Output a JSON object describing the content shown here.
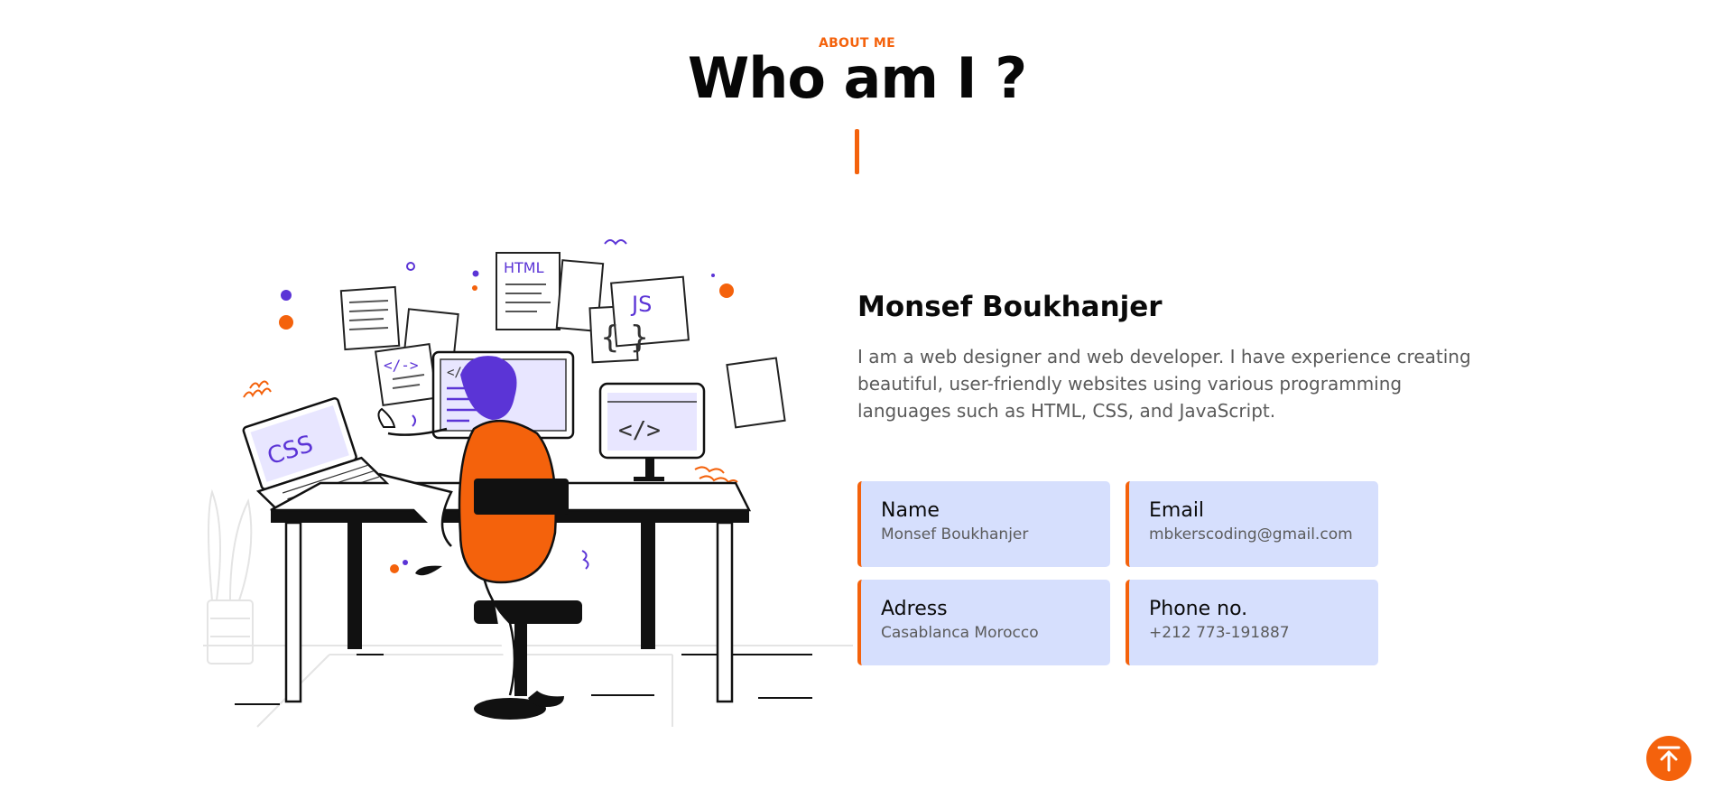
{
  "section": {
    "eyebrow": "ABOUT ME",
    "title": "Who am I ?"
  },
  "about": {
    "name": "Monsef Boukhanjer",
    "bio": "I am a web designer and web developer. I have experience creating beautiful, user-friendly websites using various programming languages such as HTML, CSS, and JavaScript."
  },
  "illustration": {
    "icon": "developer-at-desk-illustration",
    "labels": {
      "html": "HTML",
      "js": "JS",
      "css": "CSS"
    }
  },
  "info": {
    "name": {
      "label": "Name",
      "value": "Monsef Boukhanjer"
    },
    "email": {
      "label": "Email",
      "value": "mbkerscoding@gmail.com"
    },
    "address": {
      "label": "Adress",
      "value": "Casablanca Morocco"
    },
    "phone": {
      "label": "Phone no.",
      "value": "+212 773-191887"
    }
  },
  "scroll_top": {
    "icon": "arrow-up-icon"
  },
  "colors": {
    "accent": "#f4620c",
    "card_bg": "#d6dffd",
    "illustration_purple": "#5b34d6"
  }
}
